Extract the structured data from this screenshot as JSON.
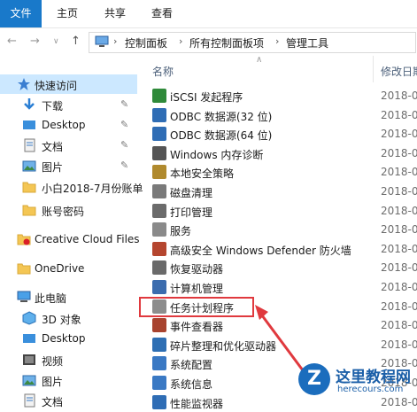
{
  "ribbon": {
    "tabs": [
      "文件",
      "主页",
      "共享",
      "查看"
    ]
  },
  "address": {
    "crumbs": [
      "控制面板",
      "所有控制面板项",
      "管理工具"
    ]
  },
  "nav": {
    "items": [
      {
        "label": "快速访问",
        "icon": "star-icon"
      },
      {
        "label": "下载",
        "icon": "download-icon"
      },
      {
        "label": "Desktop",
        "icon": "desktop-icon"
      },
      {
        "label": "文档",
        "icon": "documents-icon"
      },
      {
        "label": "图片",
        "icon": "pictures-icon"
      },
      {
        "label": "小白2018-7月份账单",
        "icon": "folder-icon"
      },
      {
        "label": "账号密码",
        "icon": "folder-icon"
      },
      {
        "label": "Creative Cloud Files",
        "icon": "creative-cloud-icon"
      },
      {
        "label": "OneDrive",
        "icon": "onedrive-icon"
      },
      {
        "label": "此电脑",
        "icon": "computer-icon"
      },
      {
        "label": "3D 对象",
        "icon": "3d-objects-icon"
      },
      {
        "label": "Desktop",
        "icon": "desktop-icon"
      },
      {
        "label": "视频",
        "icon": "videos-icon"
      },
      {
        "label": "图片",
        "icon": "pictures-icon"
      },
      {
        "label": "文档",
        "icon": "documents-icon"
      }
    ]
  },
  "columns": {
    "name": "名称",
    "modified": "修改日期"
  },
  "files": [
    {
      "name": "iSCSI 发起程序",
      "date": "2018-0",
      "icon": "iscsi-icon",
      "color": "#2f8a3a"
    },
    {
      "name": "ODBC 数据源(32 位)",
      "date": "2018-0",
      "icon": "odbc-icon",
      "color": "#2f6db5"
    },
    {
      "name": "ODBC 数据源(64 位)",
      "date": "2018-0",
      "icon": "odbc-icon",
      "color": "#2f6db5"
    },
    {
      "name": "Windows 内存诊断",
      "date": "2018-0",
      "icon": "memory-diagnostic-icon",
      "color": "#555555"
    },
    {
      "name": "本地安全策略",
      "date": "2018-0",
      "icon": "security-policy-icon",
      "color": "#b08a2e"
    },
    {
      "name": "磁盘清理",
      "date": "2018-0",
      "icon": "disk-cleanup-icon",
      "color": "#7a7a7a"
    },
    {
      "name": "打印管理",
      "date": "2018-0",
      "icon": "print-icon",
      "color": "#6b6b6b"
    },
    {
      "name": "服务",
      "date": "2018-0",
      "icon": "services-icon",
      "color": "#8a8a8a"
    },
    {
      "name": "高级安全 Windows Defender 防火墙",
      "date": "2018-0",
      "icon": "firewall-icon",
      "color": "#b5462f"
    },
    {
      "name": "恢复驱动器",
      "date": "2018-0",
      "icon": "recovery-drive-icon",
      "color": "#6a6a6a"
    },
    {
      "name": "计算机管理",
      "date": "2018-0",
      "icon": "computer-management-icon",
      "color": "#3b6cae"
    },
    {
      "name": "任务计划程序",
      "date": "2018-0",
      "icon": "task-scheduler-icon",
      "color": "#8d8d8d"
    },
    {
      "name": "事件查看器",
      "date": "2018-0",
      "icon": "event-viewer-icon",
      "color": "#a8432f"
    },
    {
      "name": "碎片整理和优化驱动器",
      "date": "2018-0",
      "icon": "defrag-icon",
      "color": "#2e6fb4"
    },
    {
      "name": "系统配置",
      "date": "2018-0",
      "icon": "system-config-icon",
      "color": "#3a79c4"
    },
    {
      "name": "系统信息",
      "date": "2018-0",
      "icon": "system-info-icon",
      "color": "#3a79c4"
    },
    {
      "name": "性能监视器",
      "date": "2018-0",
      "icon": "performance-monitor-icon",
      "color": "#2f6db5"
    }
  ],
  "watermark": {
    "title": "这里教程网",
    "url": "herecours.com",
    "logo": "Z"
  }
}
